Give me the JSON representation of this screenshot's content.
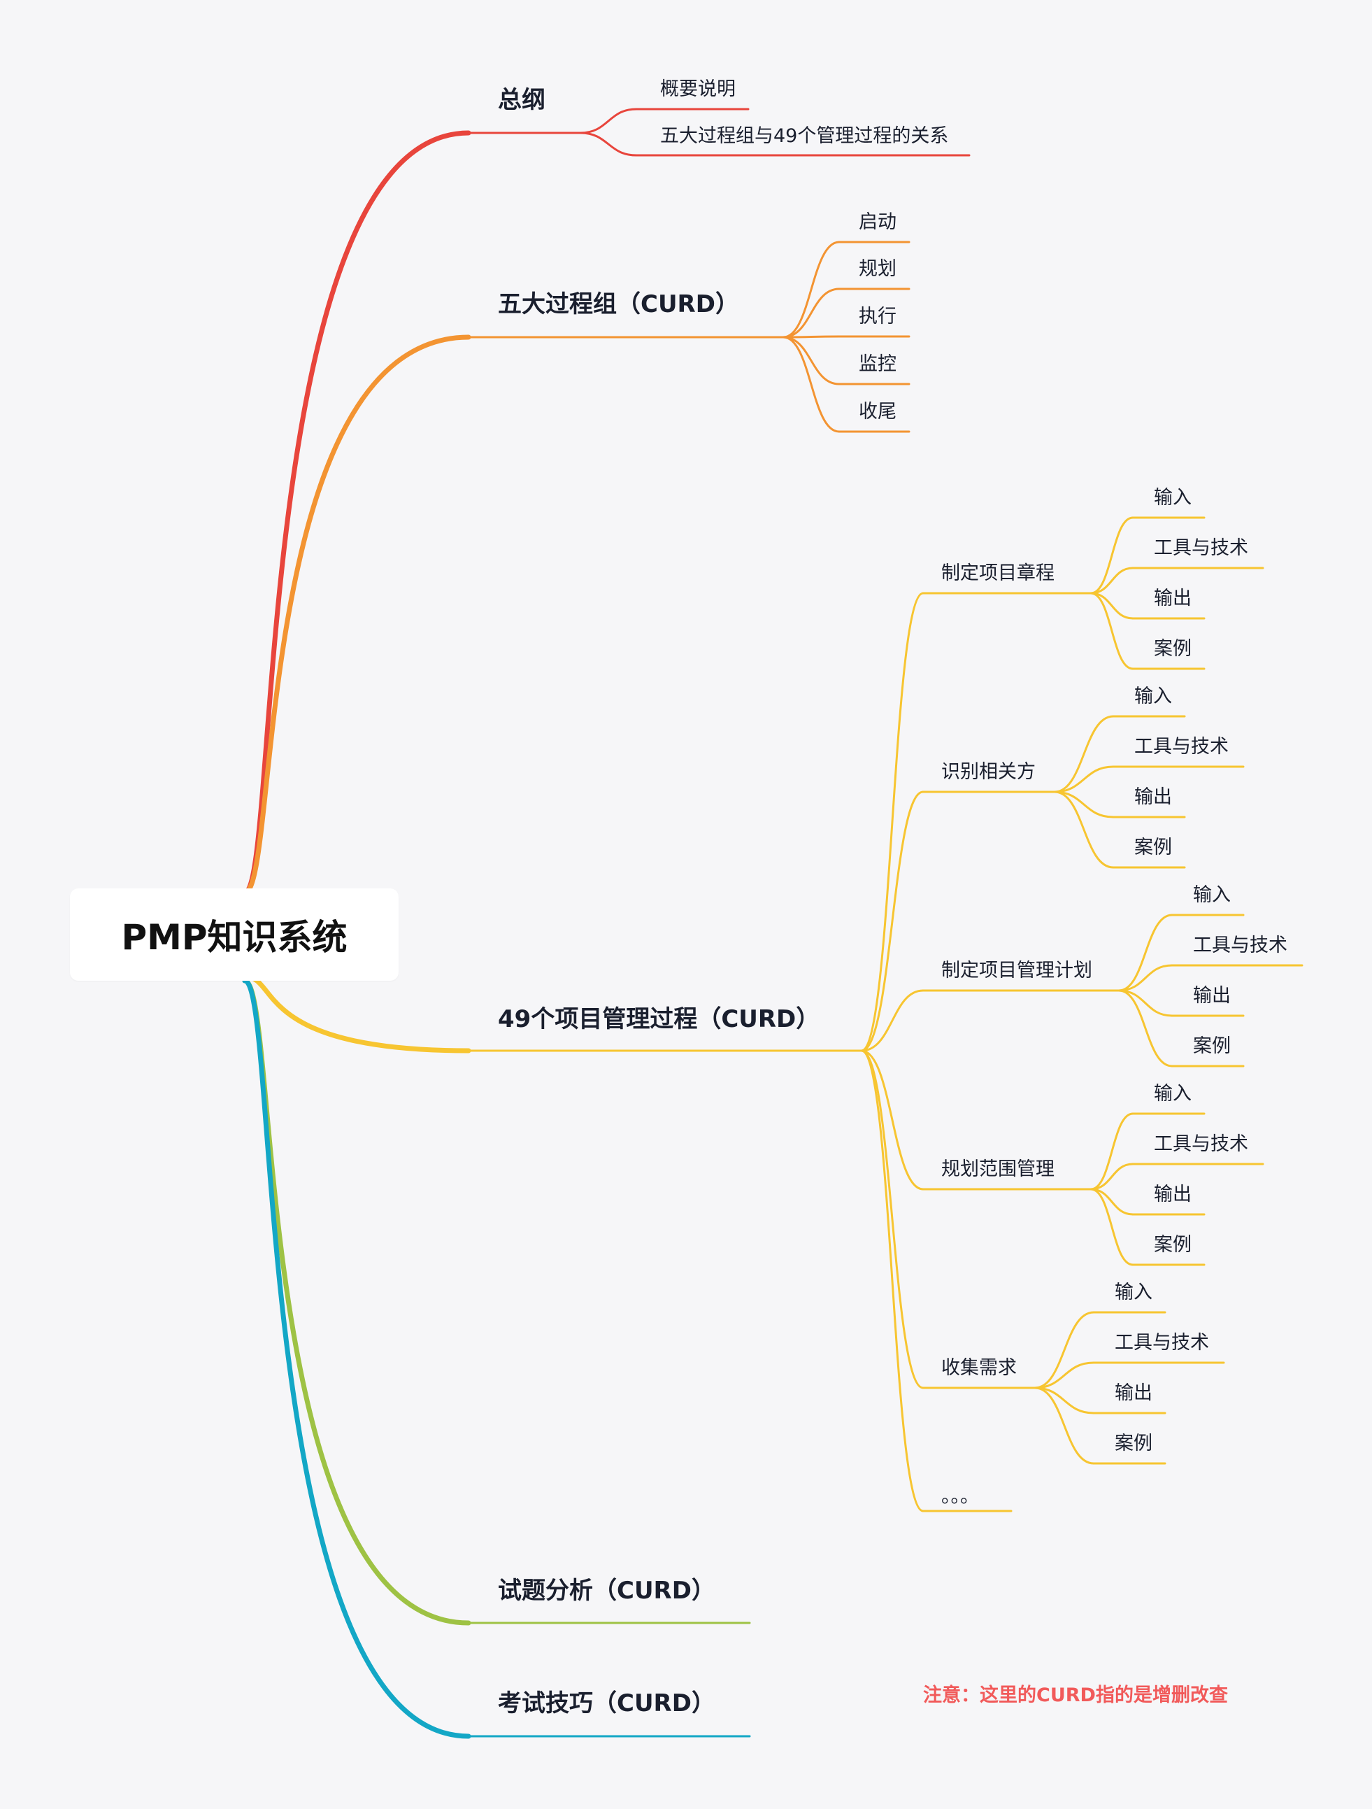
{
  "root": {
    "label": "PMP知识系统"
  },
  "branches": [
    {
      "key": "overview",
      "label": "总纲",
      "color": "#e8453c",
      "children": [
        {
          "label": "概要说明"
        },
        {
          "label": "五大过程组与49个管理过程的关系"
        }
      ]
    },
    {
      "key": "process-groups",
      "label": "五大过程组（CURD）",
      "color": "#f39432",
      "children": [
        {
          "label": "启动"
        },
        {
          "label": "规划"
        },
        {
          "label": "执行"
        },
        {
          "label": "监控"
        },
        {
          "label": "收尾"
        }
      ]
    },
    {
      "key": "processes-49",
      "label": "49个项目管理过程（CURD）",
      "color": "#f7c531",
      "children": [
        {
          "label": "制定项目章程",
          "children": [
            {
              "label": "输入"
            },
            {
              "label": "工具与技术"
            },
            {
              "label": "输出"
            },
            {
              "label": "案例"
            }
          ]
        },
        {
          "label": "识别相关方",
          "children": [
            {
              "label": "输入"
            },
            {
              "label": "工具与技术"
            },
            {
              "label": "输出"
            },
            {
              "label": "案例"
            }
          ]
        },
        {
          "label": "制定项目管理计划",
          "children": [
            {
              "label": "输入"
            },
            {
              "label": "工具与技术"
            },
            {
              "label": "输出"
            },
            {
              "label": "案例"
            }
          ]
        },
        {
          "label": "规划范围管理",
          "children": [
            {
              "label": "输入"
            },
            {
              "label": "工具与技术"
            },
            {
              "label": "输出"
            },
            {
              "label": "案例"
            }
          ]
        },
        {
          "label": "收集需求",
          "children": [
            {
              "label": "输入"
            },
            {
              "label": "工具与技术"
            },
            {
              "label": "输出"
            },
            {
              "label": "案例"
            }
          ]
        },
        {
          "label": "。。。"
        }
      ]
    },
    {
      "key": "exam-analysis",
      "label": "试题分析（CURD）",
      "color": "#9ec244",
      "children": []
    },
    {
      "key": "exam-tips",
      "label": "考试技巧（CURD）",
      "color": "#13a7c6",
      "children": []
    }
  ],
  "note": {
    "text": "注意：这里的CURD指的是增删改查",
    "color": "#f15a5a"
  }
}
